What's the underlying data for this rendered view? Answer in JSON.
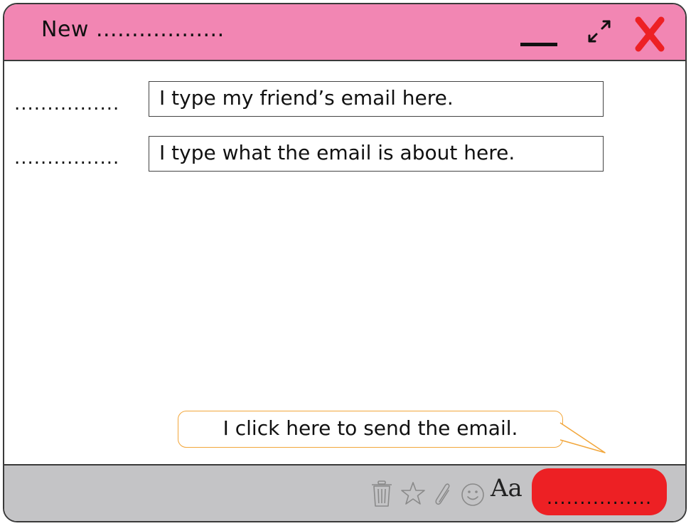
{
  "window": {
    "title": "New .................."
  },
  "fields": [
    {
      "label": "................",
      "value": "I type my friend’s email here."
    },
    {
      "label": "................",
      "value": "I type what the email is about here."
    }
  ],
  "callout": {
    "text": "I click here to send the email."
  },
  "toolbar": {
    "icons": [
      "trash-icon",
      "star-icon",
      "paperclip-icon",
      "smiley-icon"
    ],
    "font_label": "Aa",
    "send_label": "................"
  },
  "colors": {
    "titlebar": "#f286b3",
    "bottombar": "#c4c4c6",
    "send_button": "#ed2024",
    "close_x": "#ed2024",
    "callout_border": "#f2a63a"
  }
}
